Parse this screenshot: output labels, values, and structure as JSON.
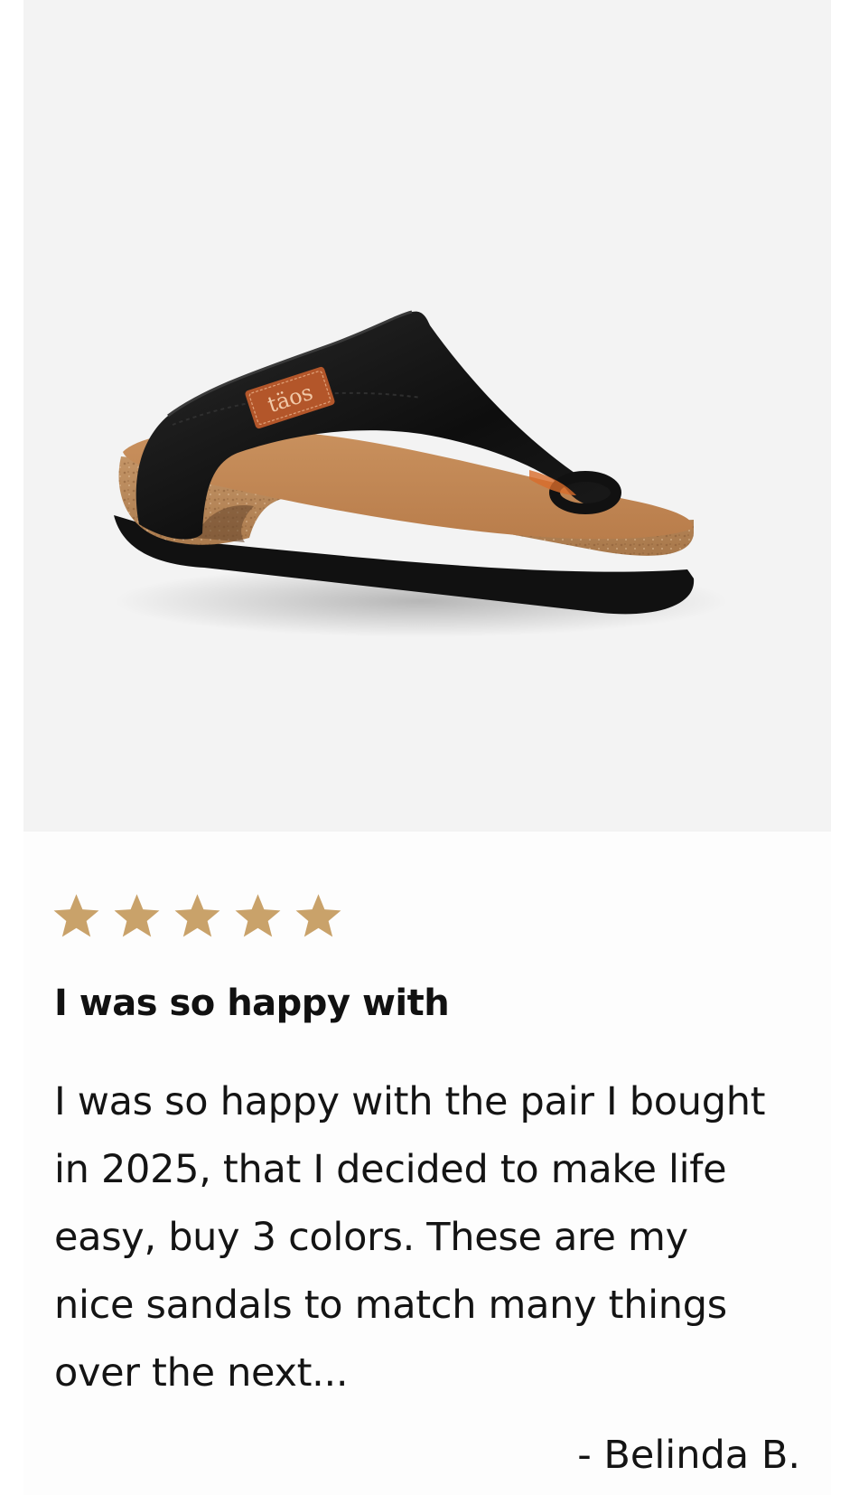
{
  "product": {
    "image_alt": "Black leather toe-loop slide sandal with cork footbed",
    "brand_tag": "täos"
  },
  "review": {
    "rating": 5,
    "rating_max": 5,
    "star_color": "#c9a26a",
    "title": "I was so happy with",
    "body": "I was so happy with the pair I bought in 2025, that I decided to make life easy, buy 3 colors. These are my nice sandals to match many things over the next...",
    "author": "- Belinda B."
  }
}
